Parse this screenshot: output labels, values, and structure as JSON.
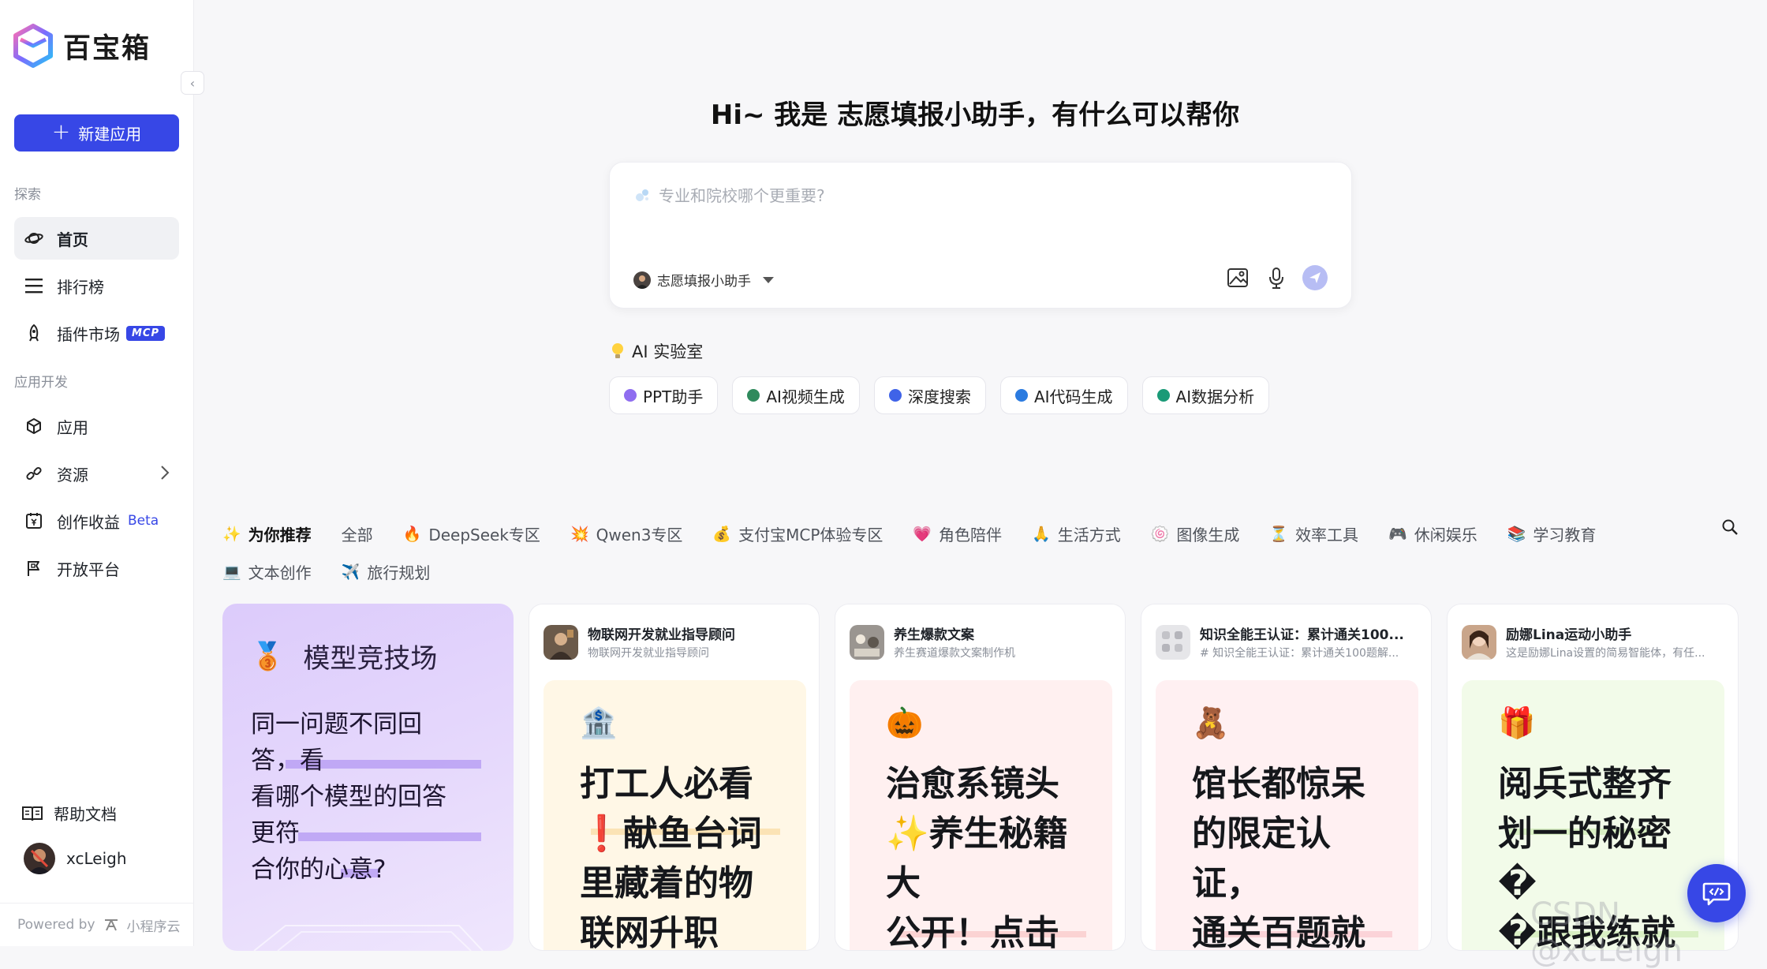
{
  "sidebar": {
    "brand": "百宝箱",
    "new_app_label": "新建应用",
    "section_explore": "探索",
    "nav_explore": [
      {
        "label": "首页"
      },
      {
        "label": "排行榜"
      },
      {
        "label": "插件市场",
        "badge": "MCP"
      }
    ],
    "section_dev": "应用开发",
    "nav_dev": [
      {
        "label": "应用"
      },
      {
        "label": "资源"
      },
      {
        "label": "创作收益",
        "badge": "Beta"
      },
      {
        "label": "开放平台"
      }
    ],
    "help_label": "帮助文档",
    "username": "xcLeigh",
    "powered_prefix": "Powered by",
    "powered_brand": "小程序云"
  },
  "hero": {
    "title": "Hi~ 我是 志愿填报小助手，有什么可以帮你"
  },
  "chat": {
    "placeholder": "专业和院校哪个更重要?",
    "agent_name": "志愿填报小助手"
  },
  "lab": {
    "title": "AI 实验室",
    "chips": [
      {
        "label": "PPT助手",
        "color": "#8f6df0"
      },
      {
        "label": "AI视频生成",
        "color": "#2f8a5c"
      },
      {
        "label": "深度搜索",
        "color": "#3f63e8"
      },
      {
        "label": "AI代码生成",
        "color": "#2b7be0"
      },
      {
        "label": "AI数据分析",
        "color": "#1a9a77"
      }
    ]
  },
  "categories": {
    "row1": [
      {
        "emoji": "✨",
        "label": "为你推荐",
        "active": true
      },
      {
        "emoji": "",
        "label": "全部"
      },
      {
        "emoji": "🔥",
        "label": "DeepSeek专区"
      },
      {
        "emoji": "💥",
        "label": "Qwen3专区"
      },
      {
        "emoji": "💰",
        "label": "支付宝MCP体验专区"
      },
      {
        "emoji": "💗",
        "label": "角色陪伴"
      },
      {
        "emoji": "🙏",
        "label": "生活方式"
      },
      {
        "emoji": "🍥",
        "label": "图像生成"
      },
      {
        "emoji": "⏳",
        "label": "效率工具"
      },
      {
        "emoji": "🎮",
        "label": "休闲娱乐"
      },
      {
        "emoji": "📚",
        "label": "学习教育"
      }
    ],
    "row2": [
      {
        "emoji": "💻",
        "label": "文本创作"
      },
      {
        "emoji": "✈️",
        "label": "旅行规划"
      }
    ]
  },
  "arena": {
    "medal": "🥉",
    "title": "模型竞技场",
    "lines": [
      "同一问题不同回",
      "答，看",
      "看哪个模型的回答",
      "更符",
      "合你的心意?"
    ]
  },
  "cards": [
    {
      "name": "物联网开发就业指导顾问",
      "sub": "物联网开发就业指导顾问",
      "emoji": "🏦",
      "lines": [
        "打工人必看",
        "❗献鱼台词",
        "里藏着的物",
        "联网升职"
      ],
      "bg": "#fff7e6",
      "line_color": "#fbe3b5"
    },
    {
      "name": "养生爆款文案",
      "sub": "养生赛道爆款文案制作机",
      "emoji": "🎃",
      "lines": [
        "治愈系镜头",
        "✨养生秘籍",
        "大",
        "公开！点击"
      ],
      "bg": "#fff0f0",
      "line_color": "#fbd3d3"
    },
    {
      "name": "知识全能王认证：累计通关100...",
      "sub": "# 知识全能王认证：累计通关100题解...",
      "emoji": "🧸",
      "lines": [
        "馆长都惊呆",
        "的限定认",
        "证，",
        "通关百题就"
      ],
      "bg": "#fff0f2",
      "line_color": "#fbd3d8"
    },
    {
      "name": "励娜Lina运动小助手",
      "sub": "这是励娜Lina设置的简易智能体，有任...",
      "emoji": "🎁",
      "lines": [
        "阅兵式整齐",
        "划一的秘密",
        "�",
        "�跟我练就"
      ],
      "bg": "#f2fbe9",
      "line_color": "#d9f0c4"
    }
  ],
  "watermark": "CSDN @xcLeigh"
}
